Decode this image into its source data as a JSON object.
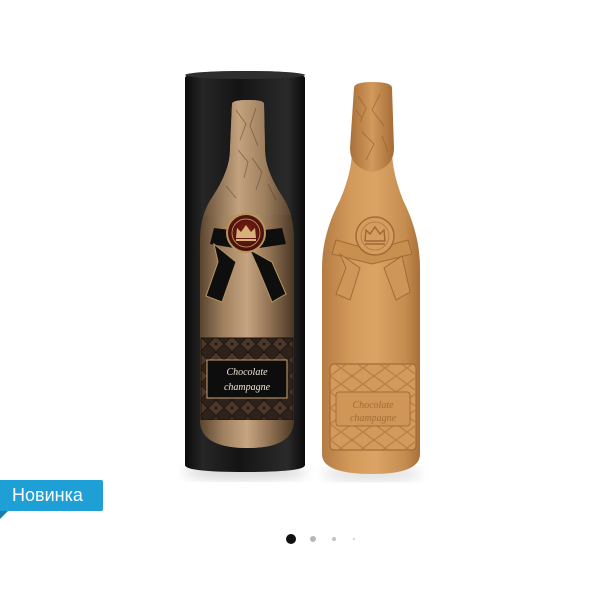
{
  "product_gallery": {
    "badge": {
      "label": "Новинка",
      "color": "#1ea0d6"
    },
    "box_label": {
      "line1": "Chocolate",
      "line2": "champagne"
    },
    "bottle_embossed_label": {
      "line1": "Chocolate",
      "line2": "champagne"
    },
    "icons": [
      "crown-emblem-icon",
      "crown-embossed-icon"
    ],
    "pagination": {
      "total": 4,
      "active": 1,
      "active_color": "#111111",
      "inactive_color": "#b7b7b7"
    }
  }
}
